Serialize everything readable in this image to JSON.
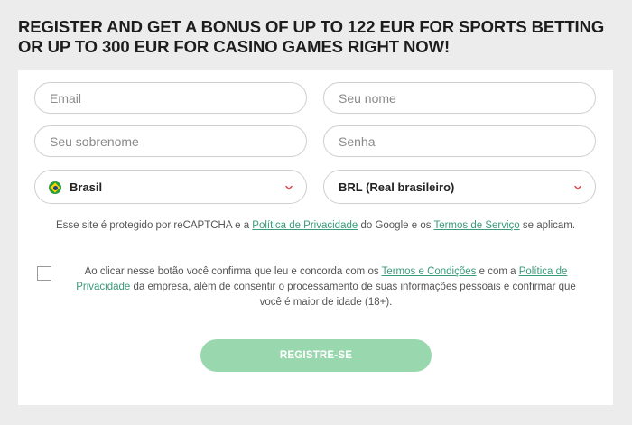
{
  "headline": "REGISTER AND GET A BONUS OF UP TO 122 EUR FOR SPORTS BETTING OR UP TO 300 EUR FOR CASINO GAMES RIGHT NOW!",
  "form": {
    "email_placeholder": "Email",
    "first_name_placeholder": "Seu nome",
    "last_name_placeholder": "Seu sobrenome",
    "password_placeholder": "Senha",
    "country": {
      "selected": "Brasil",
      "flag_icon": "brazil-flag-icon"
    },
    "currency": {
      "selected": "BRL (Real brasileiro)"
    },
    "chevron_color": "#e0454f"
  },
  "recaptcha": {
    "text_1": "Esse site é protegido por reCAPTCHA e a ",
    "privacy_link": "Política de Privacidade",
    "text_2": " do Google e os ",
    "terms_link": "Termos de Serviço",
    "text_3": " se aplicam."
  },
  "consent": {
    "checked": false,
    "text_1": "Ao clicar nesse botão você confirma que leu e concorda com os ",
    "terms_link": "Termos e Condições",
    "text_2": " e com a ",
    "privacy_link": "Política de Privacidade",
    "text_3": " da empresa, além de consentir o processamento de suas informações pessoais e confirmar que você é maior de idade (18+)."
  },
  "submit_label": "REGISTRE-SE",
  "colors": {
    "accent": "#99d8ae",
    "link": "#3a9a7a",
    "background": "#ececec"
  }
}
